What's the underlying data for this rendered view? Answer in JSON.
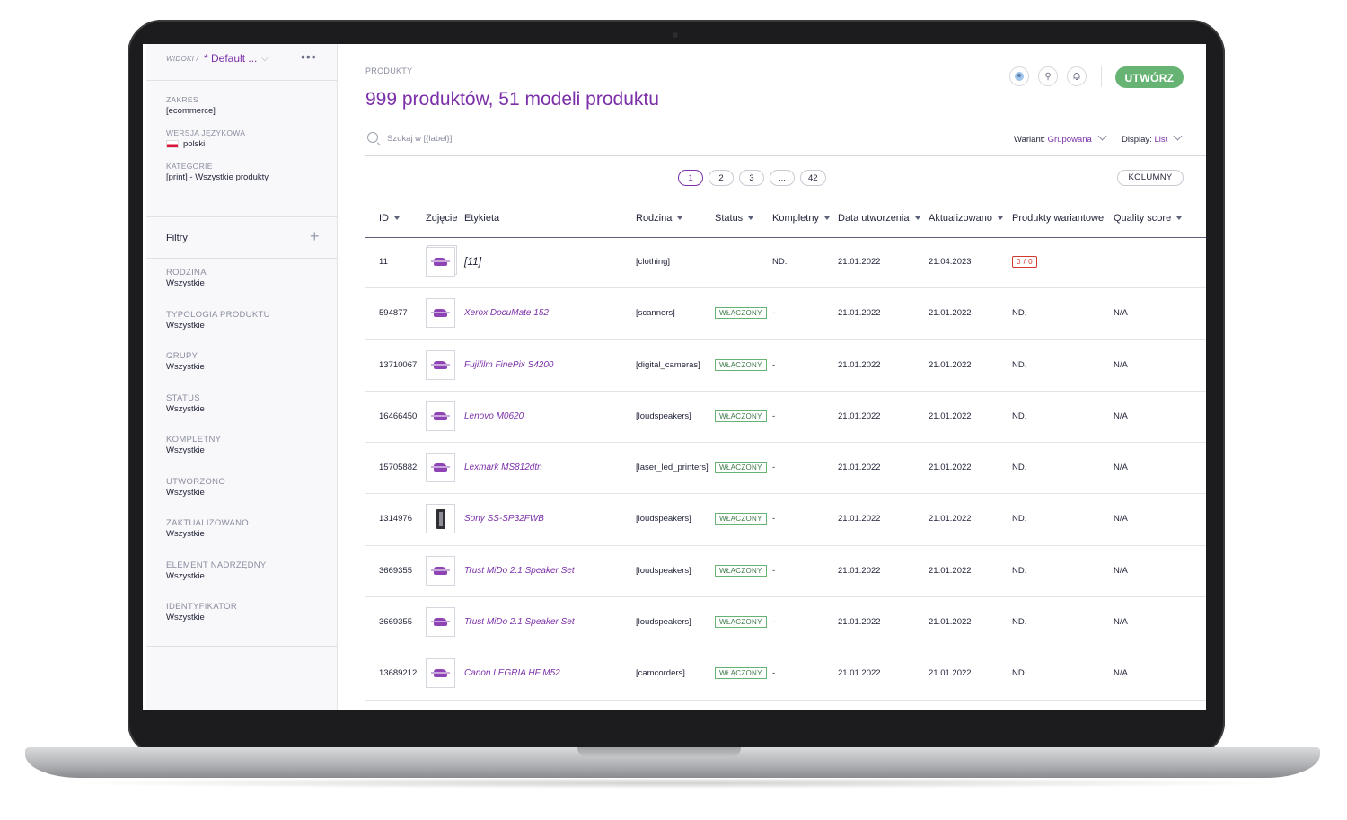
{
  "sidebar": {
    "views_label": "WIDOKI /",
    "view_name": "* Default ...",
    "scope": {
      "label": "ZAKRES",
      "value": "[ecommerce]"
    },
    "locale": {
      "label": "WERSJA JĘZYKOWA",
      "value": "polski"
    },
    "category": {
      "label": "KATEGORIE",
      "value": "[print] - Wszystkie produkty"
    },
    "filters_title": "Filtry",
    "filters": [
      {
        "label": "RODZINA",
        "value": "Wszystkie"
      },
      {
        "label": "TYPOLOGIA PRODUKTU",
        "value": "Wszystkie"
      },
      {
        "label": "GRUPY",
        "value": "Wszystkie"
      },
      {
        "label": "STATUS",
        "value": "Wszystkie"
      },
      {
        "label": "KOMPLETNY",
        "value": "Wszystkie"
      },
      {
        "label": "UTWORZONO",
        "value": "Wszystkie"
      },
      {
        "label": "ZAKTUALIZOWANO",
        "value": "Wszystkie"
      },
      {
        "label": "ELEMENT NADRZĘDNY",
        "value": "Wszystkie"
      },
      {
        "label": "IDENTYFIKATOR",
        "value": "Wszystkie"
      }
    ]
  },
  "header": {
    "breadcrumb": "PRODUKTY",
    "title": "999 produktów, 51 modeli produktu",
    "create_label": "UTWÓRZ"
  },
  "search": {
    "placeholder": "Szukaj w [{label}]",
    "variant_label": "Wariant:",
    "variant_value": "Grupowana",
    "display_label": "Display:",
    "display_value": "List"
  },
  "pagination": {
    "pages": [
      "1",
      "2",
      "3",
      "...",
      "42"
    ],
    "active": "1"
  },
  "columns_button": "KOLUMNY",
  "table": {
    "headers": {
      "id": "ID",
      "image": "Zdjęcie",
      "label": "Etykieta",
      "family": "Rodzina",
      "status": "Status",
      "complete": "Kompletny",
      "created": "Data utworzenia",
      "updated": "Aktualizowano",
      "variants": "Produkty wariantowe",
      "quality": "Quality score"
    },
    "rows": [
      {
        "id": "11",
        "label": "[11]",
        "family": "[clothing]",
        "status": "",
        "complete": "ND.",
        "created": "21.01.2022",
        "updated": "21.04.2023",
        "variants": "0 / 0",
        "quality": ""
      },
      {
        "id": "594877",
        "label": "Xerox DocuMate 152",
        "family": "[scanners]",
        "status": "WŁĄCZONY",
        "complete": "-",
        "created": "21.01.2022",
        "updated": "21.01.2022",
        "variants": "ND.",
        "quality": "N/A"
      },
      {
        "id": "13710067",
        "label": "Fujifilm FinePix S4200",
        "family": "[digital_cameras]",
        "status": "WŁĄCZONY",
        "complete": "-",
        "created": "21.01.2022",
        "updated": "21.01.2022",
        "variants": "ND.",
        "quality": "N/A"
      },
      {
        "id": "16466450",
        "label": "Lenovo M0620",
        "family": "[loudspeakers]",
        "status": "WŁĄCZONY",
        "complete": "-",
        "created": "21.01.2022",
        "updated": "21.01.2022",
        "variants": "ND.",
        "quality": "N/A"
      },
      {
        "id": "15705882",
        "label": "Lexmark MS812dtn",
        "family": "[laser_led_printers]",
        "status": "WŁĄCZONY",
        "complete": "-",
        "created": "21.01.2022",
        "updated": "21.01.2022",
        "variants": "ND.",
        "quality": "N/A"
      },
      {
        "id": "1314976",
        "label": "Sony SS-SP32FWB",
        "family": "[loudspeakers]",
        "status": "WŁĄCZONY",
        "complete": "-",
        "created": "21.01.2022",
        "updated": "21.01.2022",
        "variants": "ND.",
        "quality": "N/A"
      },
      {
        "id": "3669355",
        "label": "Trust MiDo 2.1 Speaker Set",
        "family": "[loudspeakers]",
        "status": "WŁĄCZONY",
        "complete": "-",
        "created": "21.01.2022",
        "updated": "21.01.2022",
        "variants": "ND.",
        "quality": "N/A"
      },
      {
        "id": "3669355",
        "label": "Trust MiDo 2.1 Speaker Set",
        "family": "[loudspeakers]",
        "status": "WŁĄCZONY",
        "complete": "-",
        "created": "21.01.2022",
        "updated": "21.01.2022",
        "variants": "ND.",
        "quality": "N/A"
      },
      {
        "id": "13689212",
        "label": "Canon LEGRIA HF M52",
        "family": "[camcorders]",
        "status": "WŁĄCZONY",
        "complete": "-",
        "created": "21.01.2022",
        "updated": "21.01.2022",
        "variants": "ND.",
        "quality": "N/A"
      }
    ]
  },
  "colors": {
    "accent": "#7b2fa8",
    "create": "#67b373",
    "text": "#1f2237",
    "muted": "#8a8d9f"
  }
}
